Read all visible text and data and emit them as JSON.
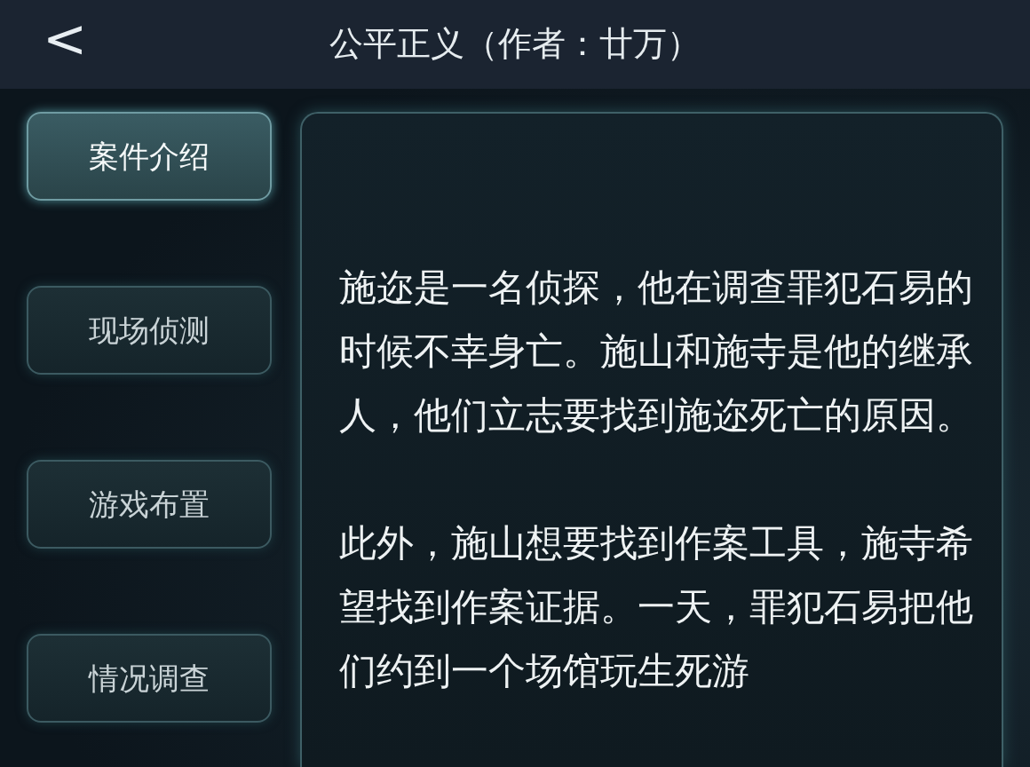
{
  "header": {
    "back": "<",
    "title": "公平正义（作者：廿万）"
  },
  "tabs": [
    {
      "label": "案件介绍",
      "selected": true
    },
    {
      "label": "现场侦测",
      "selected": false
    },
    {
      "label": "游戏布置",
      "selected": false
    },
    {
      "label": "情况调查",
      "selected": false
    }
  ],
  "paragraphs": [
    "施迩是一名侦探，他在调查罪犯石易的时候不幸身亡。施山和施寺是他的继承人，他们立志要找到施迩死亡的原因。",
    "此外，施山想要找到作案工具，施寺希望找到作案证据。一天，罪犯石易把他们约到一个场馆玩生死游"
  ]
}
